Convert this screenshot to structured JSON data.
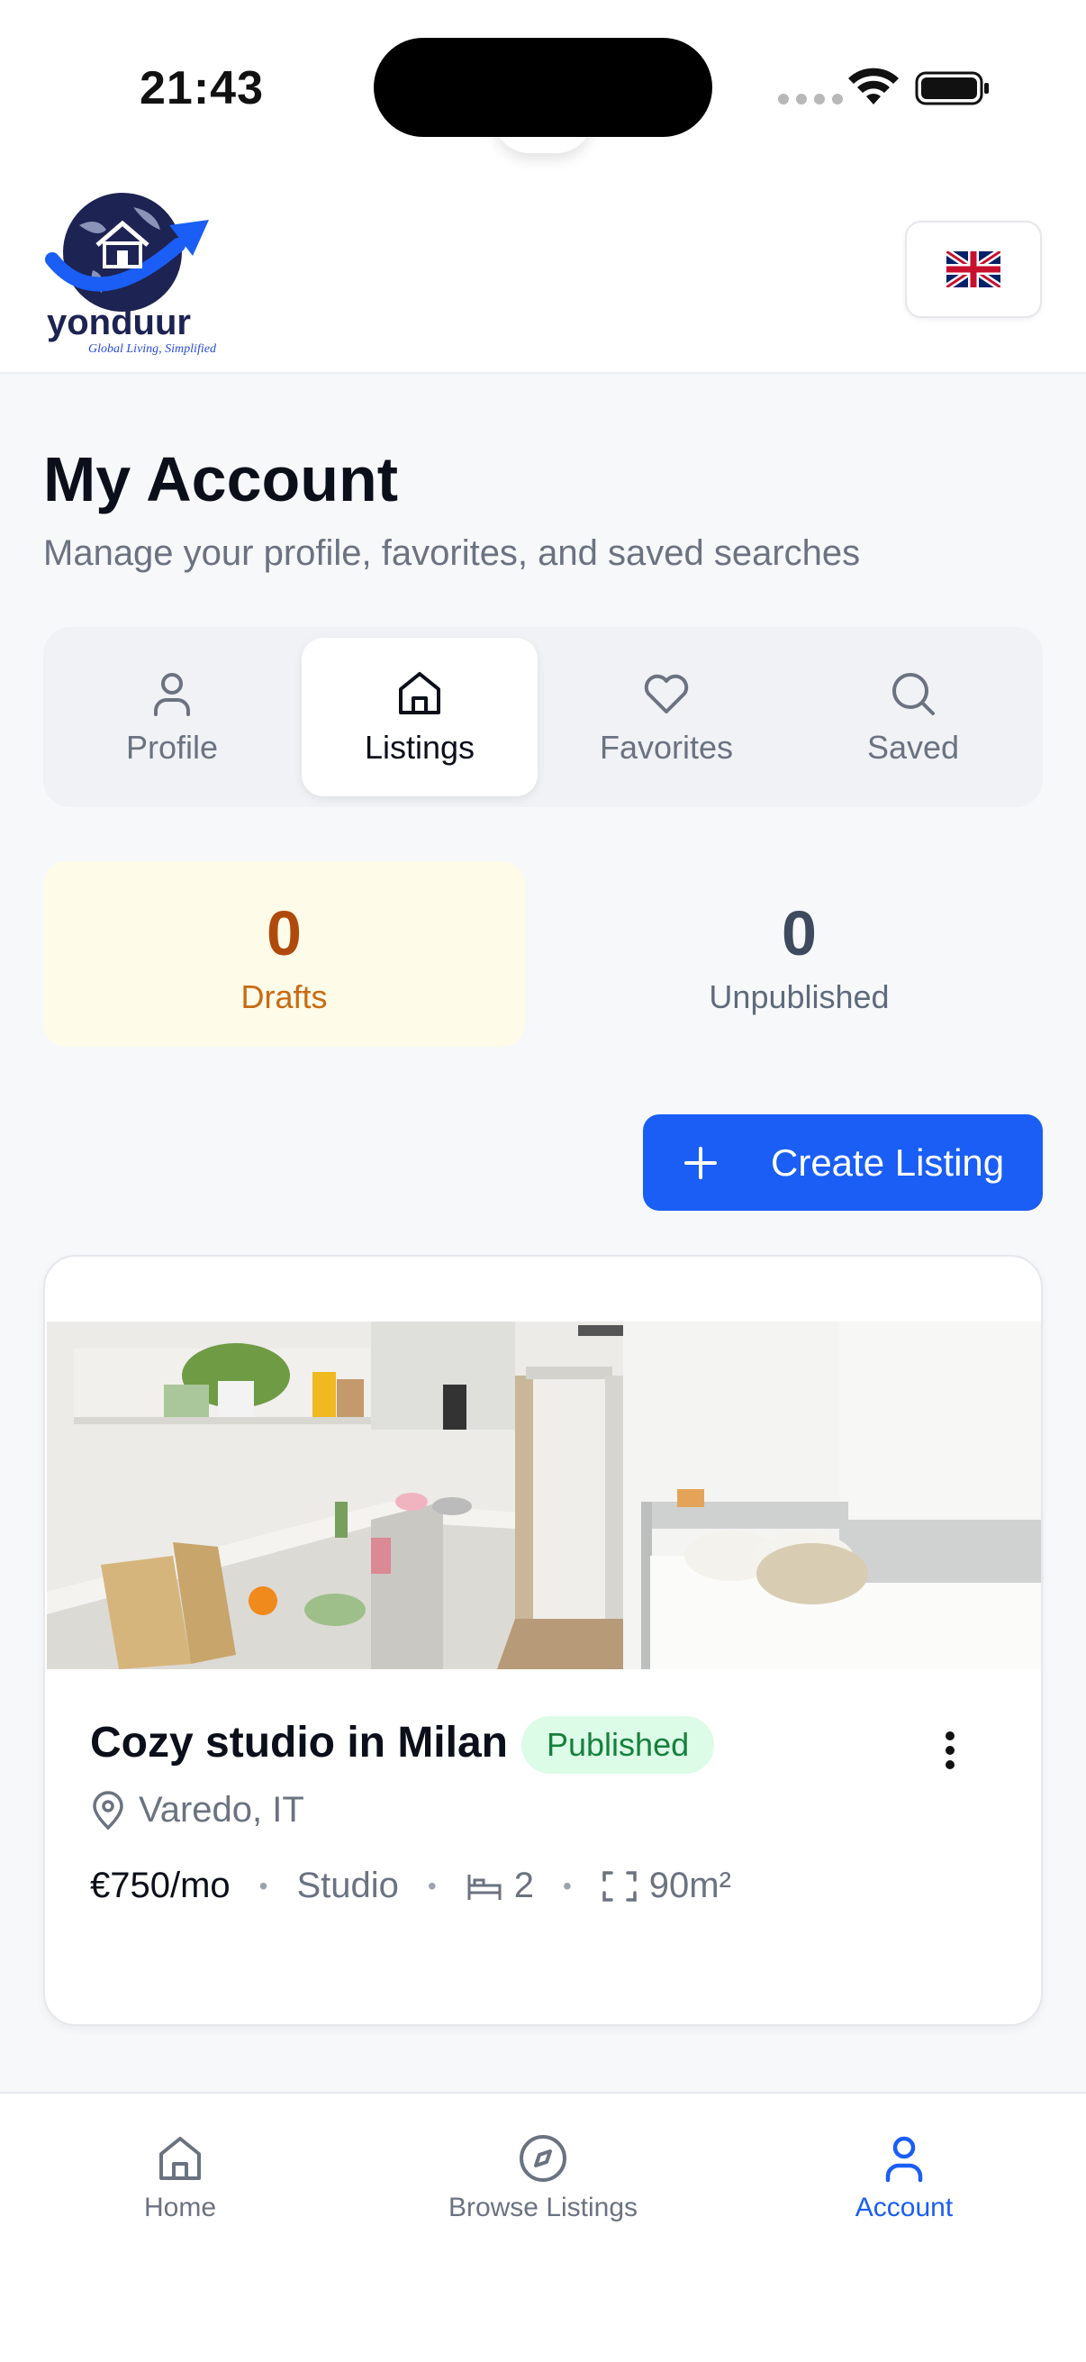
{
  "status_bar": {
    "time": "21:43"
  },
  "header": {
    "logo": {
      "word": "yonduur",
      "tagline": "Global Living, Simplified"
    },
    "language": "English (UK)"
  },
  "page": {
    "title": "My Account",
    "subtitle": "Manage your profile, favorites, and saved searches"
  },
  "tabs": [
    {
      "label": "Profile",
      "icon": "user-icon",
      "active": false
    },
    {
      "label": "Listings",
      "icon": "home-icon",
      "active": true
    },
    {
      "label": "Favorites",
      "icon": "heart-icon",
      "active": false
    },
    {
      "label": "Saved",
      "icon": "search-icon",
      "active": false
    }
  ],
  "stats": {
    "drafts": {
      "value": "0",
      "label": "Drafts"
    },
    "unpublished": {
      "value": "0",
      "label": "Unpublished"
    }
  },
  "create_button": {
    "label": "Create Listing"
  },
  "listing": {
    "title": "Cozy studio in Milan",
    "status": "Published",
    "location": "Varedo, IT",
    "price": "€750/mo",
    "type": "Studio",
    "beds": "2",
    "area": "90m²"
  },
  "bottom_nav": [
    {
      "label": "Home",
      "icon": "home-icon",
      "active": false
    },
    {
      "label": "Browse Listings",
      "icon": "compass-icon",
      "active": false
    },
    {
      "label": "Account",
      "icon": "user-icon",
      "active": true
    }
  ],
  "colors": {
    "accent": "#1a5ef5",
    "drafts_bg": "#fefbe8",
    "drafts_text": "#b04a0c",
    "published_bg": "#dcfce7",
    "published_text": "#16803c"
  }
}
